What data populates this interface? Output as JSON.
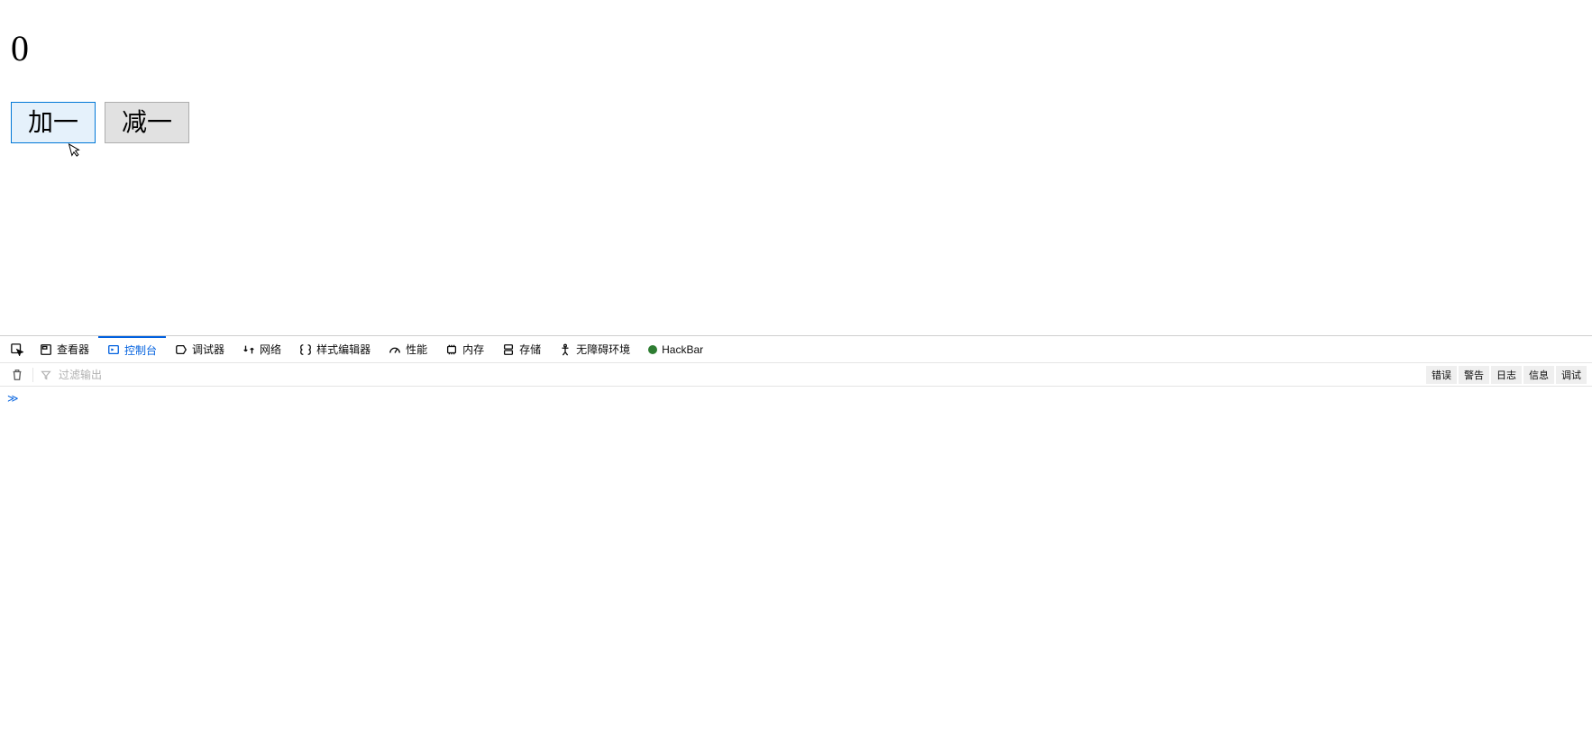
{
  "page": {
    "counter": "0",
    "buttons": {
      "increment": "加一",
      "decrement": "减一"
    }
  },
  "devtools": {
    "tabs": {
      "inspector": "查看器",
      "console": "控制台",
      "debugger": "调试器",
      "network": "网络",
      "style_editor": "样式编辑器",
      "performance": "性能",
      "memory": "内存",
      "storage": "存储",
      "accessibility": "无障碍环境",
      "hackbar": "HackBar"
    },
    "filter": {
      "placeholder": "过滤输出"
    },
    "log_filters": {
      "errors": "错误",
      "warnings": "警告",
      "logs": "日志",
      "info": "信息",
      "debug": "调试"
    },
    "console_prompt": "≫"
  }
}
